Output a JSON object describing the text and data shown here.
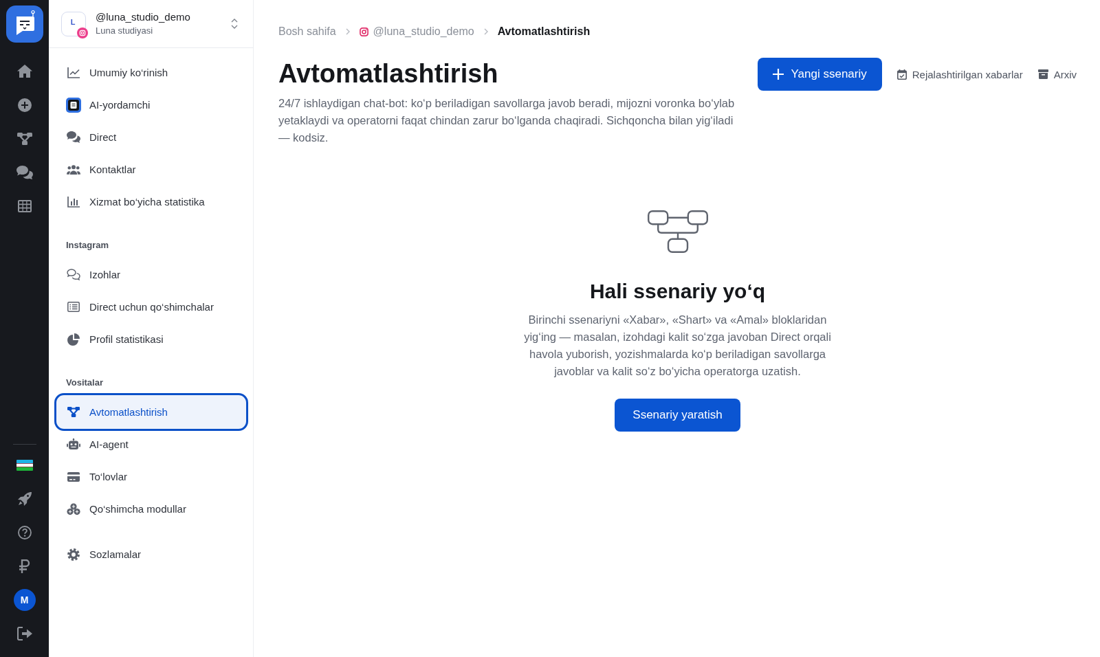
{
  "rail": {
    "avatar": "M"
  },
  "account": {
    "initial": "L",
    "name": "@luna_studio_demo",
    "subtitle": "Luna studiyasi"
  },
  "nav": [
    {
      "items": [
        {
          "label": "Umumiy ko‘rinish",
          "selected": false
        },
        {
          "label": "AI-yordamchi",
          "selected": false
        },
        {
          "label": "Direct",
          "selected": false
        },
        {
          "label": "Kontaktlar",
          "selected": false
        },
        {
          "label": "Xizmat bo‘yicha statistika",
          "selected": false
        }
      ]
    },
    {
      "heading": "Instagram",
      "items": [
        {
          "label": "Izohlar",
          "selected": false
        },
        {
          "label": "Direct uchun qo‘shimchalar",
          "selected": false
        },
        {
          "label": "Profil statistikasi",
          "selected": false
        }
      ]
    },
    {
      "heading": "Vositalar",
      "items": [
        {
          "label": "Avtomatlashtirish",
          "selected": true
        },
        {
          "label": "AI-agent",
          "selected": false
        },
        {
          "label": "To‘lovlar",
          "selected": false
        },
        {
          "label": "Qo‘shimcha modullar",
          "selected": false
        }
      ]
    },
    {
      "items": [
        {
          "label": "Sozlamalar",
          "selected": false
        }
      ]
    }
  ],
  "breadcrumb": [
    {
      "label": "Bosh sahifa",
      "kind": "page"
    },
    {
      "label": "@luna_studio_demo",
      "kind": "account"
    },
    {
      "label": "Avtomatlashtirish",
      "kind": "current"
    }
  ],
  "page": {
    "title": "Avtomatlashtirish",
    "description": "24/7 ishlaydigan chat-bot: ko‘p beriladigan savollarga javob beradi, mijozni voronka bo‘ylab yetaklaydi va operatorni faqat chindan zarur bo‘lganda chaqiradi. Sichqoncha bilan yig‘iladi — kodsiz.",
    "actions": [
      {
        "label": "Yangi ssenariy",
        "kind": "primary"
      },
      {
        "label": "Rejalashtirilgan xabarlar",
        "kind": "link"
      },
      {
        "label": "Arxiv",
        "kind": "link"
      }
    ]
  },
  "empty_state": {
    "title": "Hali ssenariy yo‘q",
    "text": "Birinchi ssenariyni «Xabar», «Shart» va «Amal» bloklaridan yig‘ing — masalan, izohdagi kalit so‘zga javoban Direct orqali havola yuborish, yozishmalarda ko‘p beriladigan savollarga javoblar va kalit so‘z bo‘yicha operatorga uzatish.",
    "button": "Ssenariy yaratish"
  }
}
